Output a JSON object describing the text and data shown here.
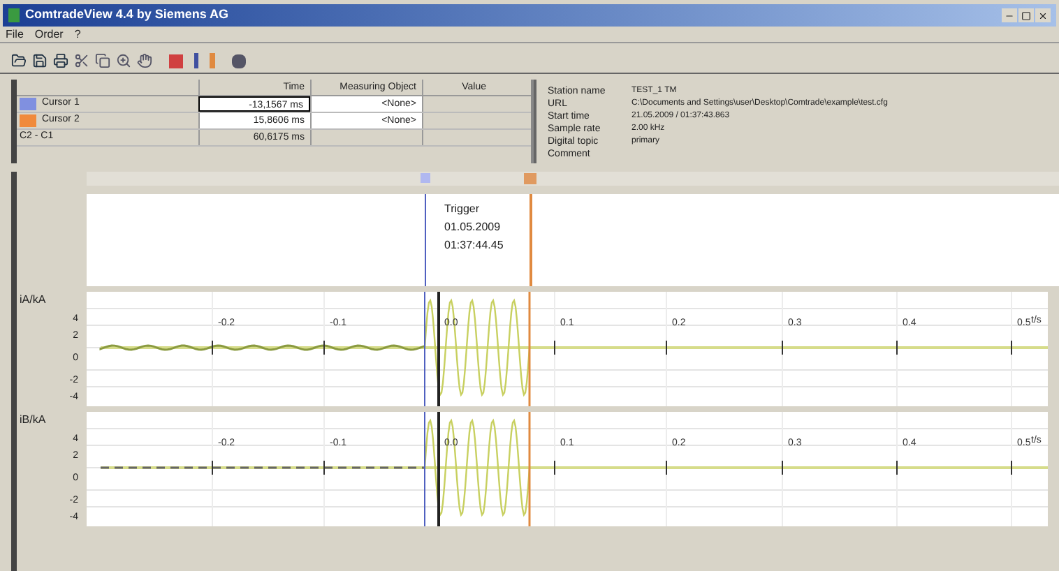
{
  "window": {
    "title": "ComtradeView 4.4 by Siemens AG"
  },
  "menu": [
    "File",
    "Order",
    "?"
  ],
  "cursor_table": {
    "columns": [
      "Time",
      "Measuring Object",
      "Value"
    ],
    "rows": [
      {
        "label": "Cursor 1",
        "color": "#8090e0",
        "time": "-13,1567 ms",
        "object": "<None>",
        "selected": true
      },
      {
        "label": "Cursor 2",
        "color": "#f08a3c",
        "time": "15,8606 ms",
        "object": "<None>",
        "selected": false
      },
      {
        "label": "C2 - C1",
        "time": "60,6175 ms",
        "selected": false
      }
    ]
  },
  "info": [
    {
      "label": "Station name",
      "value": "TEST_1 TM"
    },
    {
      "label": "URL",
      "value": "C:\\Documents and Settings\\user\\Desktop\\Comtrade\\example\\test.cfg"
    },
    {
      "label": "Start time",
      "value": "21.05.2009 / 01:37:43.863"
    },
    {
      "label": "Sample rate",
      "value": "2.00 kHz"
    },
    {
      "label": "Digital topic",
      "value": "primary"
    },
    {
      "label": "Comment"
    }
  ],
  "trigger": {
    "label": "Trigger",
    "date": "01.05.2009",
    "time": "01:37:44.45"
  },
  "charts": [
    {
      "ylabel": "iA/kA",
      "kind": "ripple",
      "yticks": [
        "4",
        "2",
        "0",
        "-2",
        "-4"
      ],
      "xticks": [
        "-0.2",
        "-0.1",
        "0.0",
        "0.1",
        "0.2",
        "0.3",
        "0.4",
        "0.5"
      ],
      "xunit": "t/s"
    },
    {
      "ylabel": "iB/kA",
      "kind": "dashed",
      "yticks": [
        "4",
        "2",
        "0",
        "-2",
        "-4"
      ],
      "xticks": [
        "-0.2",
        "-0.1",
        "0.0",
        "0.1",
        "0.2",
        "0.3",
        "0.4",
        "0.5"
      ],
      "xunit": "t/s"
    }
  ]
}
